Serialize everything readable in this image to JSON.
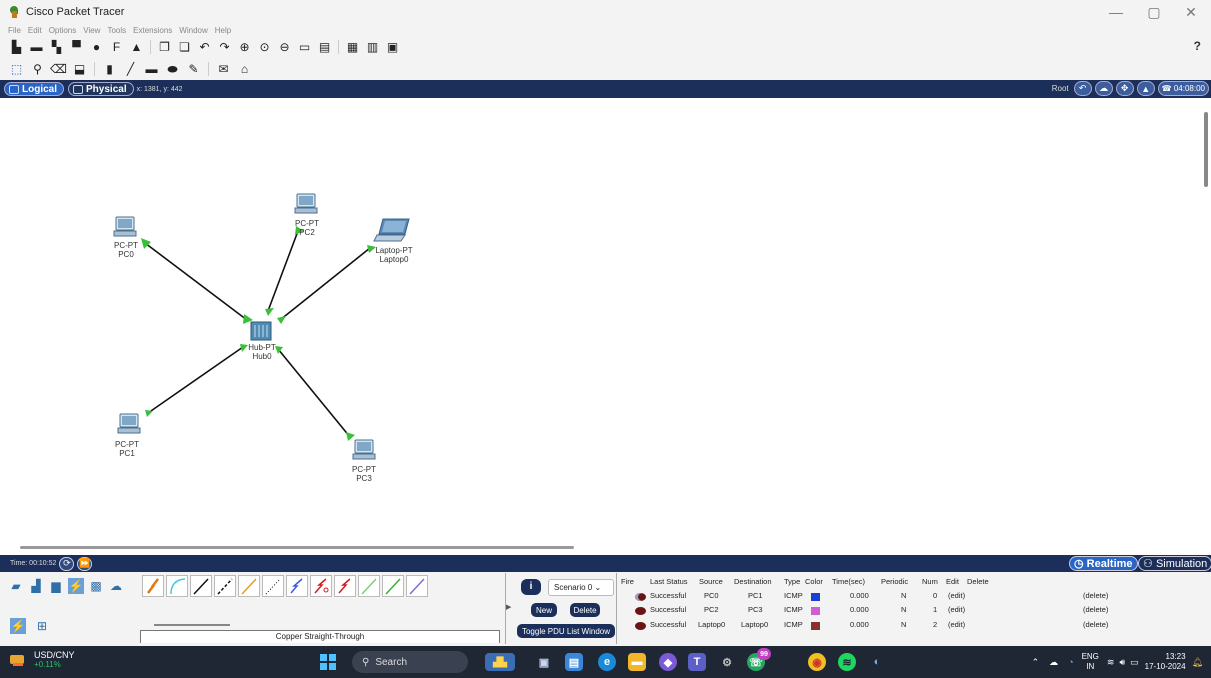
{
  "window": {
    "title": "Cisco Packet Tracer",
    "controls": [
      "—",
      "▢",
      "✕"
    ]
  },
  "menu": [
    "File",
    "Edit",
    "Options",
    "View",
    "Tools",
    "Extensions",
    "Window",
    "Help"
  ],
  "toolbar": {
    "help_label": "?"
  },
  "viewbar": {
    "logical_label": "Logical",
    "physical_label": "Physical",
    "coords": "x: 1381, y: 442",
    "root_label": "Root",
    "clock": "04:08:00"
  },
  "devices": [
    {
      "id": "pc0",
      "type": "PC-PT",
      "name": "PC0"
    },
    {
      "id": "pc2",
      "type": "PC-PT",
      "name": "PC2"
    },
    {
      "id": "laptop0",
      "type": "Laptop-PT",
      "name": "Laptop0"
    },
    {
      "id": "hub0",
      "type": "Hub-PT",
      "name": "Hub0"
    },
    {
      "id": "pc1",
      "type": "PC-PT",
      "name": "PC1"
    },
    {
      "id": "pc3",
      "type": "PC-PT",
      "name": "PC3"
    }
  ],
  "timebar": {
    "time": "Time: 00:10:52",
    "realtime_label": "Realtime",
    "simulation_label": "Simulation"
  },
  "bottom": {
    "cable_caption": "Copper Straight-Through",
    "scenario": "Scenario 0",
    "new_label": "New",
    "delete_label": "Delete",
    "toggle_label": "Toggle PDU List Window"
  },
  "pdu_table": {
    "headers": [
      "Fire",
      "Last Status",
      "Source",
      "Destination",
      "Type",
      "Color",
      "Time(sec)",
      "Periodic",
      "Num",
      "Edit",
      "Delete"
    ],
    "rows": [
      {
        "status": "Successful",
        "source": "PC0",
        "destination": "PC1",
        "type": "ICMP",
        "color": "#1a3fd6",
        "time": "0.000",
        "periodic": "N",
        "num": "0",
        "edit": "(edit)",
        "delete": "(delete)"
      },
      {
        "status": "Successful",
        "source": "PC2",
        "destination": "PC3",
        "type": "ICMP",
        "color": "#d05cd6",
        "time": "0.000",
        "periodic": "N",
        "num": "1",
        "edit": "(edit)",
        "delete": "(delete)"
      },
      {
        "status": "Successful",
        "source": "Laptop0",
        "destination": "Laptop0",
        "type": "ICMP",
        "color": "#8b2f2f",
        "time": "0.000",
        "periodic": "N",
        "num": "2",
        "edit": "(edit)",
        "delete": "(delete)"
      }
    ]
  },
  "taskbar": {
    "stock_name": "USD/CNY",
    "stock_change": "+0.11%",
    "search_placeholder": "Search",
    "notification_badge": "99",
    "lang_top": "ENG",
    "lang_bottom": "IN",
    "time": "13:23",
    "date": "17-10-2024"
  }
}
